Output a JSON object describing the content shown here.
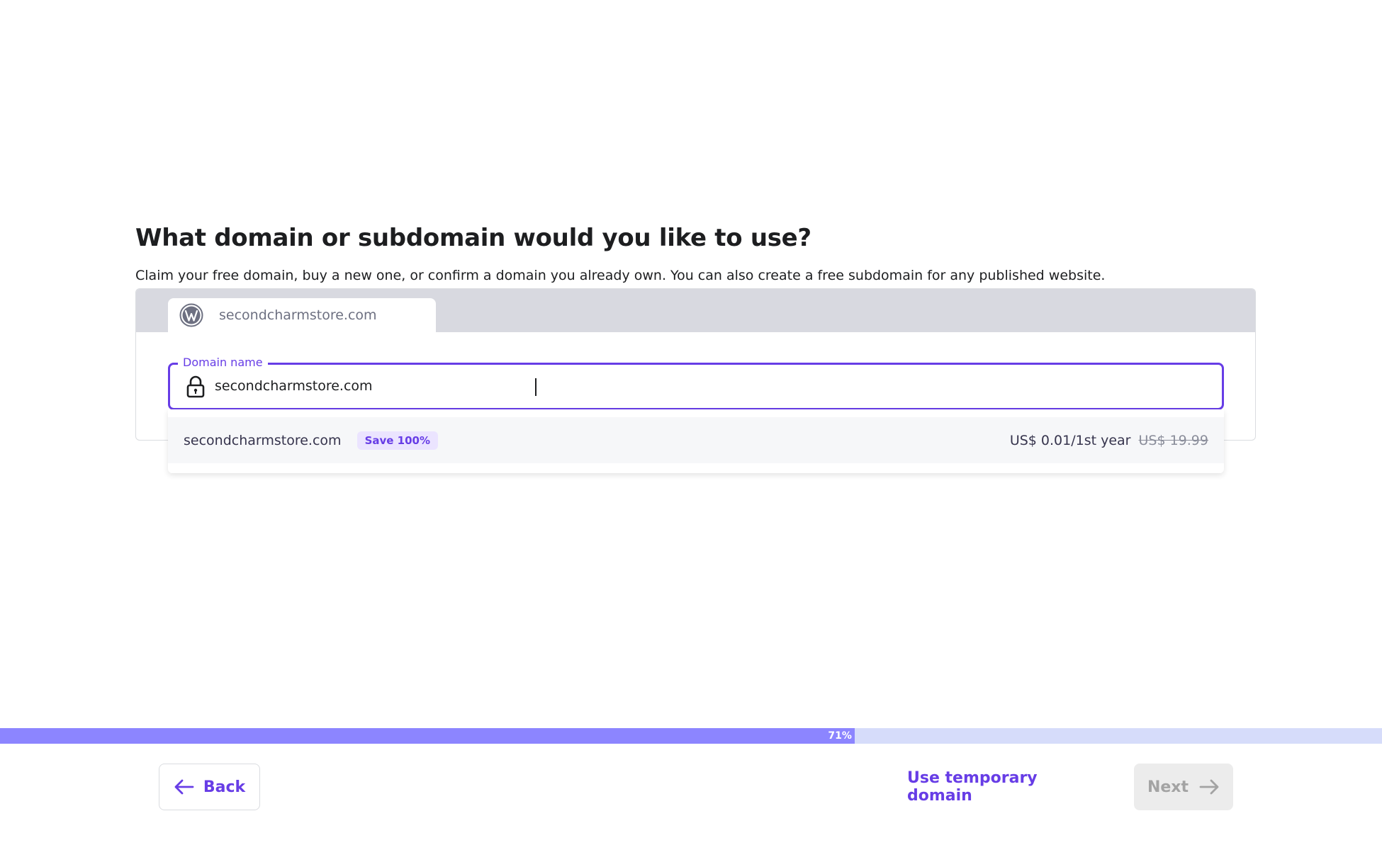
{
  "page": {
    "heading": "What domain or subdomain would you like to use?",
    "subtext": "Claim your free domain, buy a new one, or confirm a domain you already own. You can also create a free subdomain for any published website."
  },
  "site_tab": {
    "icon": "wordpress-logo",
    "label": "secondcharmstore.com"
  },
  "domain_field": {
    "label": "Domain name",
    "icon": "lock-icon",
    "value": "secondcharmstore.com"
  },
  "suggestion": {
    "domain": "secondcharmstore.com",
    "badge": "Save 100%",
    "price": "US$ 0.01/1st year",
    "old_price": "US$ 19.99"
  },
  "progress": {
    "percent": 71,
    "label": "71%"
  },
  "footer": {
    "back_label": "Back",
    "temp_domain_label": "Use temporary domain",
    "next_label": "Next"
  },
  "colors": {
    "accent": "#673de6",
    "progress_fill": "#8c85ff",
    "progress_track": "#d6dcfa",
    "badge_bg": "#ebe4ff"
  }
}
